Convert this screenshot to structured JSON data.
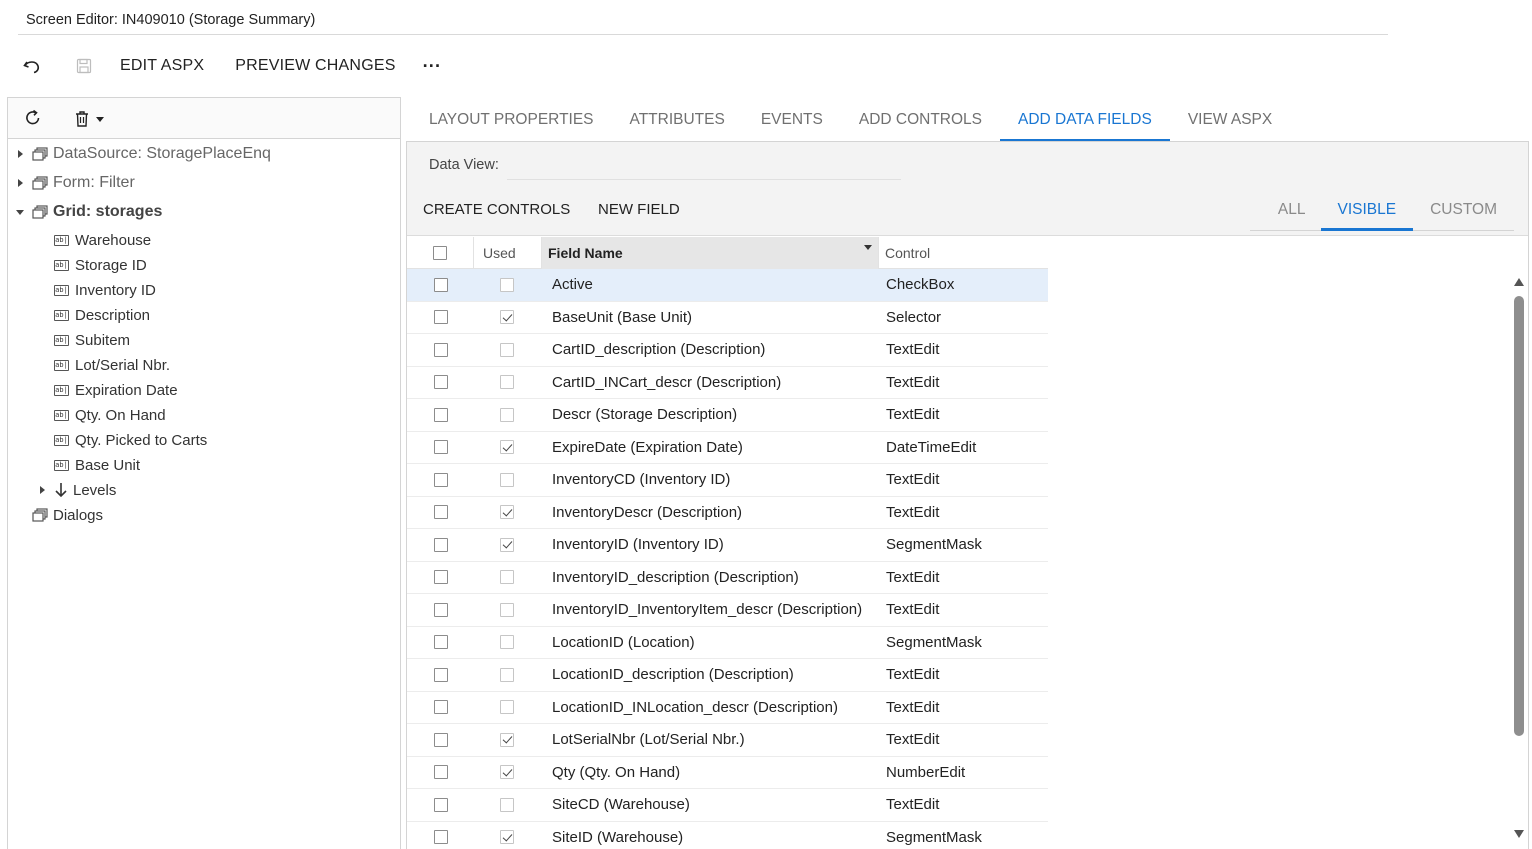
{
  "title": "Screen Editor: IN409010 (Storage Summary)",
  "toolbar": {
    "undo_icon": "undo-icon",
    "save_icon": "save-icon",
    "edit_aspx": "EDIT ASPX",
    "preview_changes": "PREVIEW CHANGES",
    "more": "···"
  },
  "tree": {
    "datasource": "DataSource: StoragePlaceEnq",
    "form": "Form: Filter",
    "grid": "Grid: storages",
    "fields": [
      "Warehouse",
      "Storage ID",
      "Inventory ID",
      "Description",
      "Subitem",
      "Lot/Serial Nbr.",
      "Expiration Date",
      "Qty. On Hand",
      "Qty. Picked to Carts",
      "Base Unit"
    ],
    "levels": "Levels",
    "dialogs": "Dialogs"
  },
  "tabs": [
    "LAYOUT PROPERTIES",
    "ATTRIBUTES",
    "EVENTS",
    "ADD CONTROLS",
    "ADD DATA FIELDS",
    "VIEW ASPX"
  ],
  "active_tab": "ADD DATA FIELDS",
  "data_view": {
    "label": "Data View:",
    "value": ""
  },
  "actions": {
    "create_controls": "CREATE CONTROLS",
    "new_field": "NEW FIELD"
  },
  "filter_tabs": [
    "ALL",
    "VISIBLE",
    "CUSTOM"
  ],
  "active_filter": "VISIBLE",
  "grid": {
    "columns": {
      "used": "Used",
      "field_name": "Field Name",
      "control": "Control"
    },
    "rows": [
      {
        "field": "Active",
        "control": "CheckBox",
        "used": false
      },
      {
        "field": "BaseUnit (Base Unit)",
        "control": "Selector",
        "used": true
      },
      {
        "field": "CartID_description (Description)",
        "control": "TextEdit",
        "used": false
      },
      {
        "field": "CartID_INCart_descr (Description)",
        "control": "TextEdit",
        "used": false
      },
      {
        "field": "Descr (Storage Description)",
        "control": "TextEdit",
        "used": false
      },
      {
        "field": "ExpireDate (Expiration Date)",
        "control": "DateTimeEdit",
        "used": true
      },
      {
        "field": "InventoryCD (Inventory ID)",
        "control": "TextEdit",
        "used": false
      },
      {
        "field": "InventoryDescr (Description)",
        "control": "TextEdit",
        "used": true
      },
      {
        "field": "InventoryID (Inventory ID)",
        "control": "SegmentMask",
        "used": true
      },
      {
        "field": "InventoryID_description (Description)",
        "control": "TextEdit",
        "used": false
      },
      {
        "field": "InventoryID_InventoryItem_descr (Description)",
        "control": "TextEdit",
        "used": false
      },
      {
        "field": "LocationID (Location)",
        "control": "SegmentMask",
        "used": false
      },
      {
        "field": "LocationID_description (Description)",
        "control": "TextEdit",
        "used": false
      },
      {
        "field": "LocationID_INLocation_descr (Description)",
        "control": "TextEdit",
        "used": false
      },
      {
        "field": "LotSerialNbr (Lot/Serial Nbr.)",
        "control": "TextEdit",
        "used": true
      },
      {
        "field": "Qty (Qty. On Hand)",
        "control": "NumberEdit",
        "used": true
      },
      {
        "field": "SiteCD (Warehouse)",
        "control": "TextEdit",
        "used": false
      },
      {
        "field": "SiteID (Warehouse)",
        "control": "SegmentMask",
        "used": true
      }
    ]
  },
  "colors": {
    "accent": "#1976d2",
    "selected_row": "#e4eefa"
  }
}
